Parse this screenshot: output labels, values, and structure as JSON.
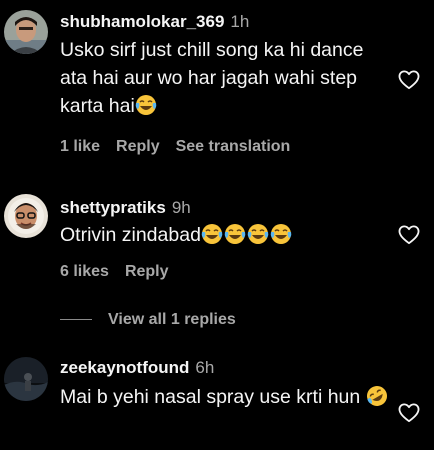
{
  "comments": [
    {
      "username": "shubhamolokar_369",
      "time": "1h",
      "text": "Usko sirf just chill song ka hi dance ata hai aur wo har jagah wahi step karta hai",
      "emoji_suffix": [
        "face-with-tears-of-joy"
      ],
      "likes_label": "1 like",
      "reply_label": "Reply",
      "translation_label": "See translation"
    },
    {
      "username": "shettypratiks",
      "time": "9h",
      "text": "Otrivin zindabad",
      "emoji_suffix": [
        "face-with-tears-of-joy",
        "face-with-tears-of-joy",
        "face-with-tears-of-joy",
        "face-with-tears-of-joy"
      ],
      "likes_label": "6 likes",
      "reply_label": "Reply"
    },
    {
      "username": "zeekaynotfound",
      "time": "6h",
      "text": "Mai b yehi nasal spray use krti hun",
      "emoji_suffix": [
        "rolling-on-the-floor-laughing"
      ]
    }
  ],
  "view_replies_label": "View all 1 replies",
  "icons": {
    "like": "heart-outline-icon"
  },
  "colors": {
    "background": "#000000",
    "primary_text": "#f5f5f5",
    "secondary_text": "#a8a8a8",
    "emoji_yellow": "#f8c43a"
  }
}
